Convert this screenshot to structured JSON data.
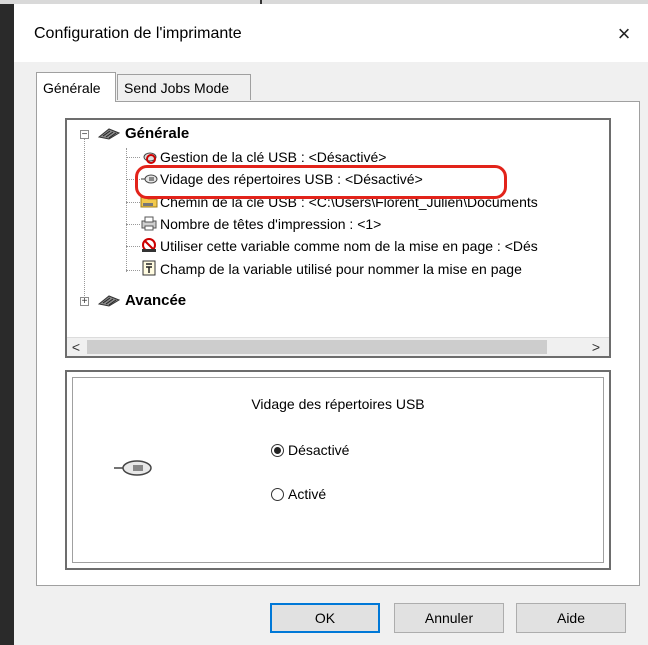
{
  "window": {
    "title": "Configuration de l'imprimante",
    "close_glyph": "×"
  },
  "tabs": [
    {
      "label": "Générale",
      "active": true
    },
    {
      "label": "Send Jobs Mode",
      "active": false
    }
  ],
  "tree": {
    "root_general": {
      "expander": "−",
      "label": "Générale",
      "icon": "settings-icon"
    },
    "items": [
      {
        "label": "Gestion de la clé USB : <Désactivé>",
        "icon": "usb-management-icon"
      },
      {
        "label": "Vidage des répertoires USB : <Désactivé>",
        "icon": "usb-key-icon",
        "highlighted": true
      },
      {
        "label": "Chemin de la clé USB : <C:\\Users\\Florent_Julien\\Documents",
        "icon": "folder-icon"
      },
      {
        "label": "Nombre de têtes d'impression : <1>",
        "icon": "printer-icon"
      },
      {
        "label": "Utiliser cette variable comme nom de la mise en page : <Dés",
        "icon": "disabled-icon"
      },
      {
        "label": "Champ de la variable utilisé pour nommer la mise en page",
        "icon": "form-field-icon"
      }
    ],
    "root_advanced": {
      "expander": "+",
      "label": "Avancée",
      "icon": "settings-icon"
    },
    "scroll_left": "<",
    "scroll_right": ">"
  },
  "detail": {
    "title": "Vidage des répertoires USB",
    "options": [
      {
        "label": "Désactivé",
        "selected": true
      },
      {
        "label": "Activé",
        "selected": false
      }
    ]
  },
  "buttons": {
    "ok": "OK",
    "cancel": "Annuler",
    "help": "Aide"
  },
  "colors": {
    "highlight": "#e2231a",
    "default_button_border": "#0078d7"
  }
}
